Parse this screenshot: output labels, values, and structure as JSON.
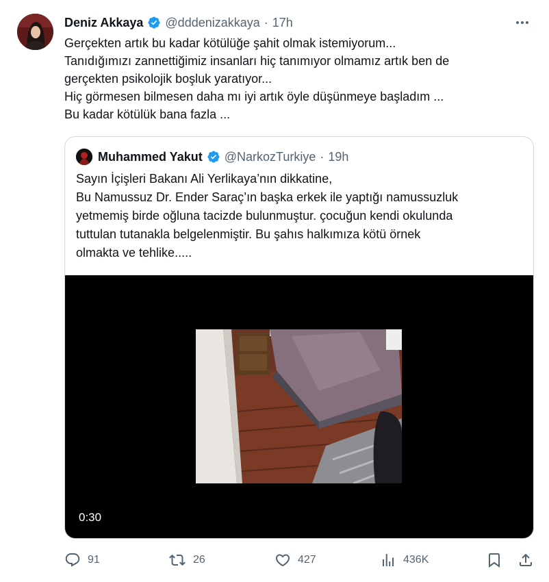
{
  "author": {
    "name": "Deniz Akkaya",
    "handle": "@dddenizakkaya",
    "separator": "·",
    "time": "17h",
    "avatar_icon": "profile-photo"
  },
  "tweet": {
    "lines": [
      "Gerçekten artık bu kadar kötülüğe şahit olmak istemiyorum...",
      "Tanıdığımızı zannettiğimiz insanları hiç tanımıyor olmamız  artık ben de",
      "gerçekten psikolojik boşluk yaratıyor...",
      "Hiç görmesen bilmesen daha mı iyi artık öyle düşünmeye başladım ...",
      "Bu kadar kötülük bana fazla ..."
    ]
  },
  "quote": {
    "name": "Muhammed Yakut",
    "handle": "@NarkozTurkiye",
    "separator": "·",
    "time": "19h",
    "lines": [
      "Sayın İçişleri Bakanı Ali Yerlikaya’nın dikkatine,",
      "Bu Namussuz Dr. Ender Saraç’ın başka erkek ile yaptığı namussuzluk",
      "yetmemiş birde oğluna tacizde bulunmuştur. çocuğun kendi okulunda",
      "tuttulan tutanakla belgelenmiştir. Bu şahıs halkımıza kötü örnek",
      "olmakta ve tehlike....."
    ],
    "video": {
      "duration": "0:30"
    }
  },
  "actions": {
    "replies": "91",
    "retweets": "26",
    "likes": "427",
    "views": "436K"
  },
  "colors": {
    "text": "#0f1419",
    "secondary": "#536471",
    "verified": "#1d9bf0",
    "border": "#cfd9de"
  }
}
